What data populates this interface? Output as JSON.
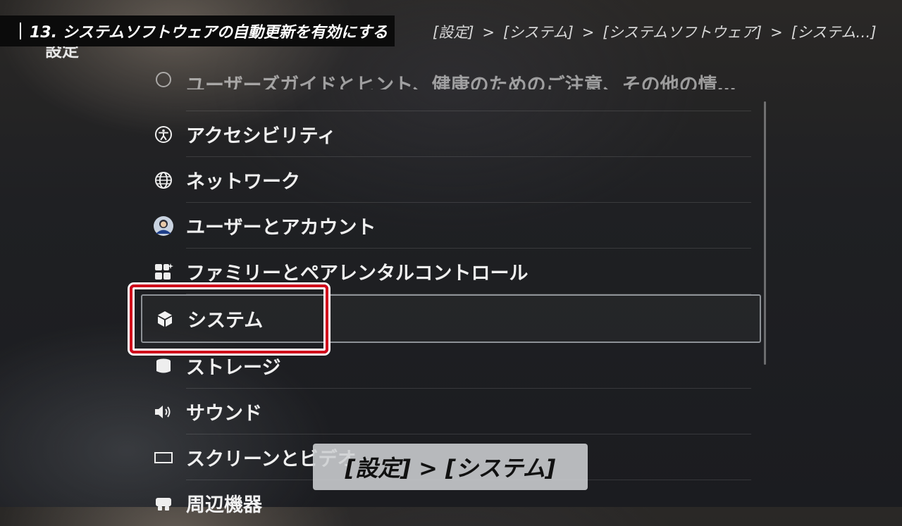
{
  "header": {
    "step_title": "13. システムソフトウェアの自動更新を有効にする",
    "breadcrumb": [
      "[設定]",
      "[システム]",
      "[システムソフトウェア]",
      "[システム…]"
    ],
    "breadcrumb_sep": ">"
  },
  "page_title": "設定",
  "menu": {
    "items": [
      {
        "label": "ユーザーズガイドとヒント、健康のためのご注意、その他の情…",
        "icon": "info-icon"
      },
      {
        "label": "アクセシビリティ",
        "icon": "accessibility-icon"
      },
      {
        "label": "ネットワーク",
        "icon": "globe-icon"
      },
      {
        "label": "ユーザーとアカウント",
        "icon": "user-avatar-icon"
      },
      {
        "label": "ファミリーとペアレンタルコントロール",
        "icon": "family-icon"
      },
      {
        "label": "システム",
        "icon": "cube-icon"
      },
      {
        "label": "ストレージ",
        "icon": "storage-icon"
      },
      {
        "label": "サウンド",
        "icon": "speaker-icon"
      },
      {
        "label": "スクリーンとビデオ",
        "icon": "screen-icon"
      },
      {
        "label": "周辺機器",
        "icon": "peripherals-icon"
      }
    ],
    "selected_index": 5
  },
  "caption": "[設定] > [システム]",
  "colors": {
    "highlight": "#d0021b",
    "background": "#1f2023",
    "caption_bg": "#cdcfd2"
  }
}
